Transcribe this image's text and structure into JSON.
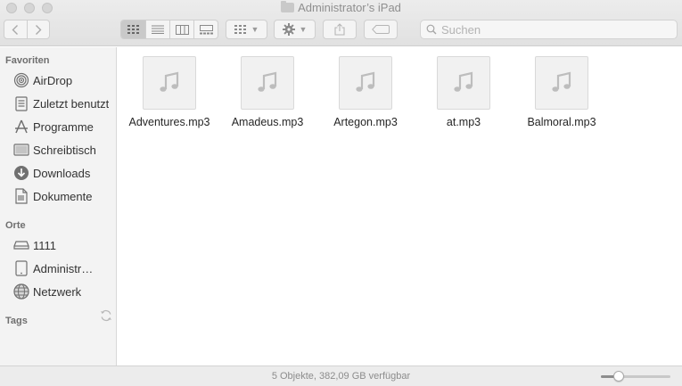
{
  "window": {
    "title": "Administrator’s iPad"
  },
  "toolbar": {
    "back_icon": "chevron-left-icon",
    "forward_icon": "chevron-right-icon"
  },
  "search": {
    "placeholder": "Suchen"
  },
  "sidebar": {
    "favorites_title": "Favoriten",
    "favorites": [
      {
        "label": "AirDrop",
        "icon": "airdrop-icon"
      },
      {
        "label": "Zuletzt benutzt",
        "icon": "recents-icon"
      },
      {
        "label": "Programme",
        "icon": "applications-icon"
      },
      {
        "label": "Schreibtisch",
        "icon": "desktop-icon"
      },
      {
        "label": "Downloads",
        "icon": "downloads-icon"
      },
      {
        "label": "Dokumente",
        "icon": "documents-icon"
      }
    ],
    "places_title": "Orte",
    "places": [
      {
        "label": "1111",
        "icon": "drive-icon"
      },
      {
        "label": "Administrator’s iPad",
        "icon": "ipad-icon"
      },
      {
        "label": "Netzwerk",
        "icon": "network-icon"
      }
    ],
    "tags_title": "Tags"
  },
  "files": [
    {
      "name": "Adventures.mp3"
    },
    {
      "name": "Amadeus.mp3"
    },
    {
      "name": "Artegon.mp3"
    },
    {
      "name": "at.mp3"
    },
    {
      "name": "Balmoral.mp3"
    }
  ],
  "status": {
    "text": "5 Objekte, 382,09 GB verfügbar",
    "icon_size_fraction": 0.25
  }
}
